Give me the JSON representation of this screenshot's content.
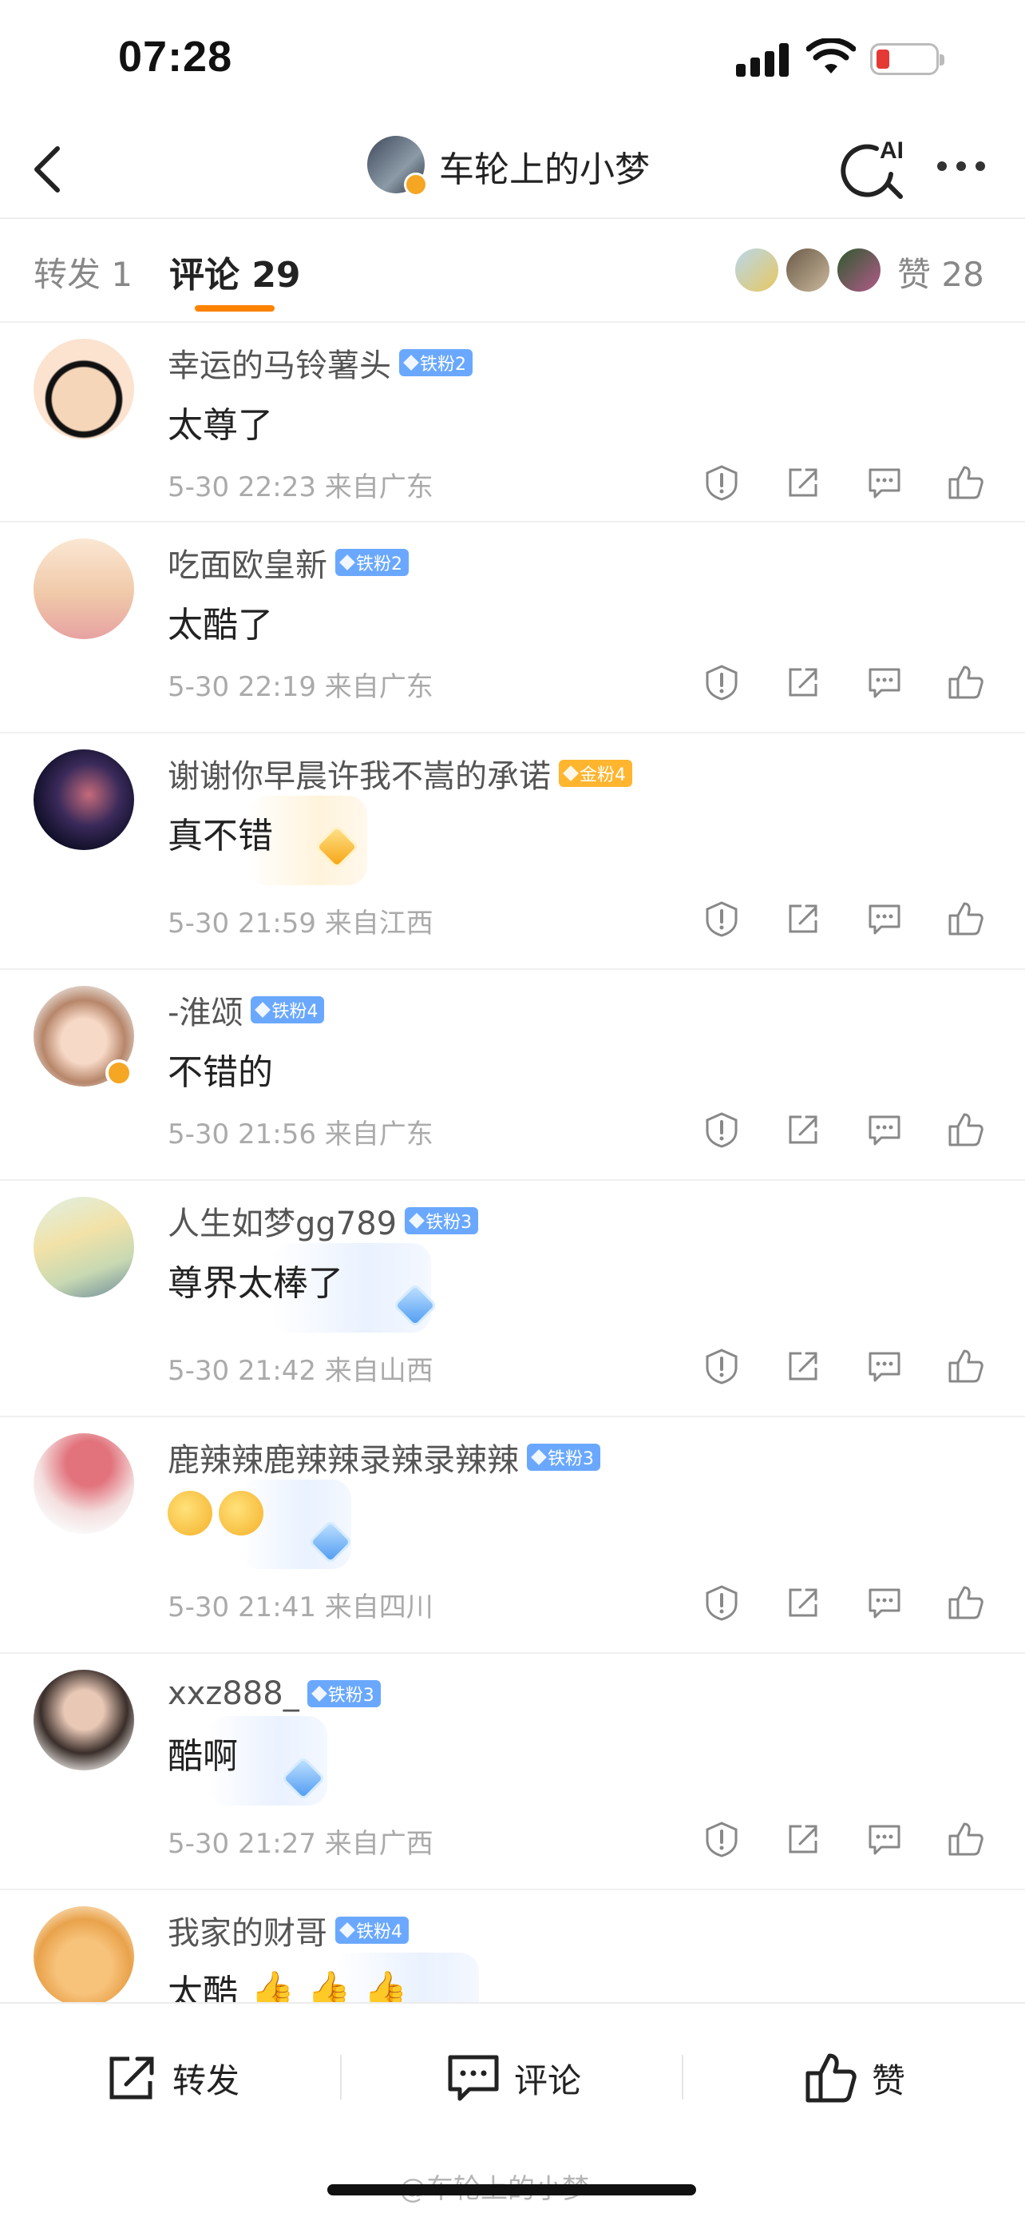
{
  "status_bar": {
    "time": "07:28",
    "battery_color": "#e53935"
  },
  "nav": {
    "title": "车轮上的小梦",
    "back_icon": "chevron-left-icon",
    "search_icon": "ai-search-icon",
    "ai_label": "AI",
    "more_icon": "more-dots-icon"
  },
  "tabs": {
    "repost": "转发 1",
    "comment": "评论 29",
    "likes": "赞 28",
    "accent": "#ff8200"
  },
  "comments": [
    {
      "name": "幸运的马铃薯头",
      "badge": "铁粉2",
      "badge_type": "iron",
      "text": "太尊了",
      "time": "5-30 22:23",
      "location": "来自广东"
    },
    {
      "name": "吃面欧皇新",
      "badge": "铁粉2",
      "badge_type": "iron",
      "text": "太酷了",
      "time": "5-30 22:19",
      "location": "来自广东"
    },
    {
      "name": "谢谢你早晨许我不嵩的承诺",
      "badge": "金粉4",
      "badge_type": "gold",
      "text": "真不错",
      "time": "5-30 21:59",
      "location": "来自江西"
    },
    {
      "name": "-淮颂",
      "badge": "铁粉4",
      "badge_type": "iron",
      "text": "不错的",
      "time": "5-30 21:56",
      "location": "来自广东"
    },
    {
      "name": "人生如梦gg789",
      "badge": "铁粉3",
      "badge_type": "iron",
      "text": "尊界太棒了",
      "time": "5-30 21:42",
      "location": "来自山西"
    },
    {
      "name": "鹿辣辣鹿辣辣录辣录辣辣",
      "badge": "铁粉3",
      "badge_type": "iron",
      "text": "",
      "time": "5-30 21:41",
      "location": "来自四川"
    },
    {
      "name": "xxz888_",
      "badge": "铁粉3",
      "badge_type": "iron",
      "text": "酷啊",
      "time": "5-30 21:27",
      "location": "来自广西"
    },
    {
      "name": "我家的财哥",
      "badge": "铁粉4",
      "badge_type": "iron",
      "text": "太酷",
      "time": "",
      "location": ""
    }
  ],
  "bottom_bar": {
    "repost": "转发",
    "comment": "评论",
    "like": "赞"
  },
  "watermark": "@车轮上的小梦"
}
